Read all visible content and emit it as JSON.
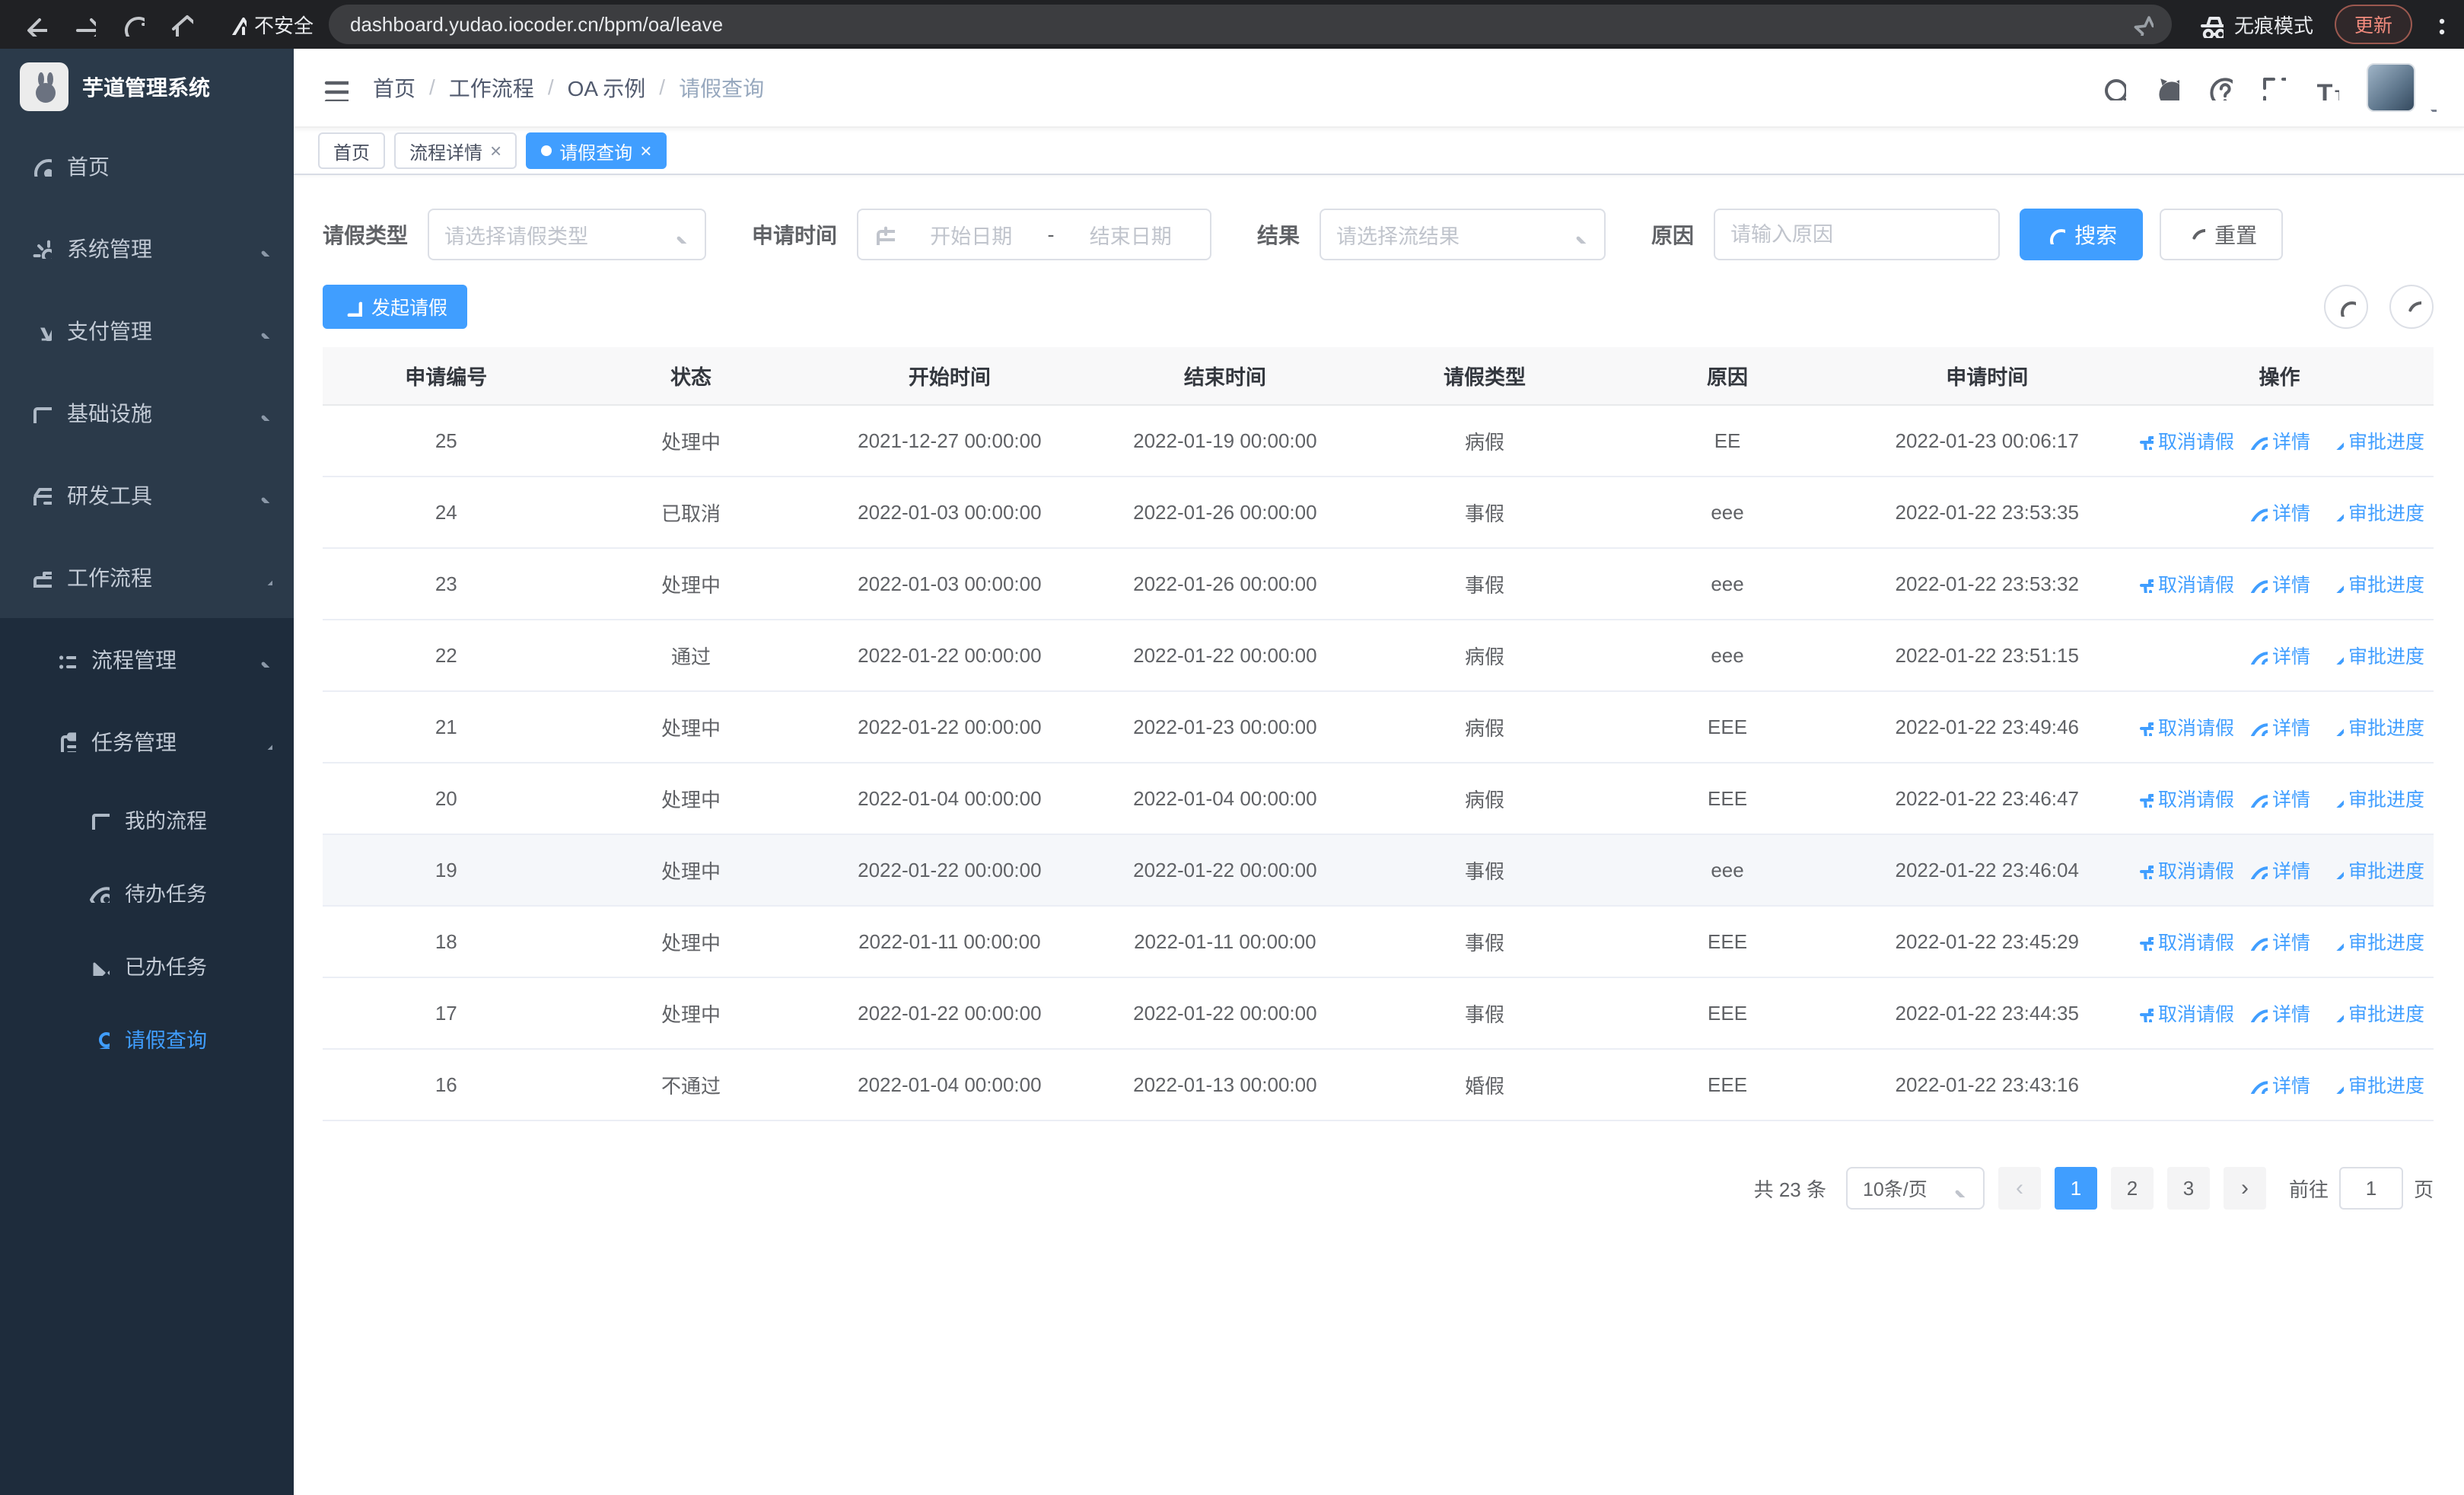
{
  "colors": {
    "accent": "#409eff",
    "sidebar_bg": "#2b3a4a",
    "submenu_bg": "#1e2c3c"
  },
  "browser": {
    "security_warning": "不安全",
    "url": "dashboard.yudao.iocoder.cn/bpm/oa/leave",
    "incognito_label": "无痕模式",
    "update_label": "更新"
  },
  "sidebar": {
    "logo_title": "芋道管理系统",
    "items": [
      {
        "key": "home",
        "icon": "dashboard-icon",
        "symbol": "sym-dashboard",
        "label": "首页"
      },
      {
        "key": "system",
        "icon": "gear-icon",
        "symbol": "sym-gear",
        "label": "系统管理",
        "chevron": "down"
      },
      {
        "key": "payment",
        "icon": "yen-icon",
        "symbol": "sym-yen",
        "label": "支付管理",
        "chevron": "down"
      },
      {
        "key": "infrastructure",
        "icon": "monitor-icon",
        "symbol": "sym-monitor",
        "label": "基础设施",
        "chevron": "down"
      },
      {
        "key": "devtools",
        "icon": "toolbox-icon",
        "symbol": "sym-box",
        "label": "研发工具",
        "chevron": "down"
      },
      {
        "key": "workflow",
        "icon": "briefcase-icon",
        "symbol": "sym-briefcase",
        "label": "工作流程",
        "chevron": "up"
      }
    ],
    "submenu": [
      {
        "key": "process-mgmt",
        "icon": "list-icon",
        "symbol": "sym-list",
        "label": "流程管理",
        "chevron": "down"
      },
      {
        "key": "task-mgmt",
        "icon": "clipboard-icon",
        "symbol": "sym-clipboard",
        "label": "任务管理",
        "chevron": "up"
      }
    ],
    "leaves": [
      {
        "key": "my-process",
        "icon": "chat-icon",
        "symbol": "sym-chat",
        "label": "我的流程"
      },
      {
        "key": "todo-tasks",
        "icon": "eye-icon",
        "symbol": "sym-eye",
        "label": "待办任务"
      },
      {
        "key": "done-tasks",
        "icon": "bowtie-icon",
        "symbol": "sym-bowtie",
        "label": "已办任务"
      },
      {
        "key": "leave-query",
        "icon": "user-icon",
        "symbol": "sym-user",
        "label": "请假查询",
        "active": true
      }
    ]
  },
  "header": {
    "breadcrumb": [
      "首页",
      "工作流程",
      "OA 示例",
      "请假查询"
    ]
  },
  "tabs": [
    {
      "label": "首页"
    },
    {
      "label": "流程详情"
    },
    {
      "label": "请假查询"
    }
  ],
  "filters": {
    "leave_type_label": "请假类型",
    "leave_type_placeholder": "请选择请假类型",
    "apply_time_label": "申请时间",
    "start_date_placeholder": "开始日期",
    "range_separator": "-",
    "end_date_placeholder": "结束日期",
    "result_label": "结果",
    "result_placeholder": "请选择流结果",
    "reason_label": "原因",
    "reason_placeholder": "请输入原因",
    "search_label": "搜索",
    "reset_label": "重置"
  },
  "toolbar": {
    "create_label": "发起请假"
  },
  "table": {
    "columns": [
      "申请编号",
      "状态",
      "开始时间",
      "结束时间",
      "请假类型",
      "原因",
      "申请时间",
      "操作"
    ],
    "actions": {
      "cancel": "取消请假",
      "detail": "详情",
      "progress": "审批进度"
    },
    "rows": [
      {
        "id": "25",
        "status": "处理中",
        "start": "2021-12-27 00:00:00",
        "end": "2022-01-19 00:00:00",
        "type": "病假",
        "reason": "EE",
        "applied": "2022-01-23 00:06:17",
        "cancellable": true
      },
      {
        "id": "24",
        "status": "已取消",
        "start": "2022-01-03 00:00:00",
        "end": "2022-01-26 00:00:00",
        "type": "事假",
        "reason": "eee",
        "applied": "2022-01-22 23:53:35",
        "cancellable": false
      },
      {
        "id": "23",
        "status": "处理中",
        "start": "2022-01-03 00:00:00",
        "end": "2022-01-26 00:00:00",
        "type": "事假",
        "reason": "eee",
        "applied": "2022-01-22 23:53:32",
        "cancellable": true
      },
      {
        "id": "22",
        "status": "通过",
        "start": "2022-01-22 00:00:00",
        "end": "2022-01-22 00:00:00",
        "type": "病假",
        "reason": "eee",
        "applied": "2022-01-22 23:51:15",
        "cancellable": false
      },
      {
        "id": "21",
        "status": "处理中",
        "start": "2022-01-22 00:00:00",
        "end": "2022-01-23 00:00:00",
        "type": "病假",
        "reason": "EEE",
        "applied": "2022-01-22 23:49:46",
        "cancellable": true
      },
      {
        "id": "20",
        "status": "处理中",
        "start": "2022-01-04 00:00:00",
        "end": "2022-01-04 00:00:00",
        "type": "病假",
        "reason": "EEE",
        "applied": "2022-01-22 23:46:47",
        "cancellable": true
      },
      {
        "id": "19",
        "status": "处理中",
        "start": "2022-01-22 00:00:00",
        "end": "2022-01-22 00:00:00",
        "type": "事假",
        "reason": "eee",
        "applied": "2022-01-22 23:46:04",
        "cancellable": true,
        "hover": true
      },
      {
        "id": "18",
        "status": "处理中",
        "start": "2022-01-11 00:00:00",
        "end": "2022-01-11 00:00:00",
        "type": "事假",
        "reason": "EEE",
        "applied": "2022-01-22 23:45:29",
        "cancellable": true
      },
      {
        "id": "17",
        "status": "处理中",
        "start": "2022-01-22 00:00:00",
        "end": "2022-01-22 00:00:00",
        "type": "事假",
        "reason": "EEE",
        "applied": "2022-01-22 23:44:35",
        "cancellable": true
      },
      {
        "id": "16",
        "status": "不通过",
        "start": "2022-01-04 00:00:00",
        "end": "2022-01-13 00:00:00",
        "type": "婚假",
        "reason": "EEE",
        "applied": "2022-01-22 23:43:16",
        "cancellable": false
      }
    ]
  },
  "pagination": {
    "total_label": "共 23 条",
    "page_size": "10条/页",
    "prev_label": "‹",
    "next_label": "›",
    "pages": [
      "1",
      "2",
      "3"
    ],
    "active_page": "1",
    "goto_label": "前往",
    "goto_value": "1",
    "page_label": "页"
  }
}
